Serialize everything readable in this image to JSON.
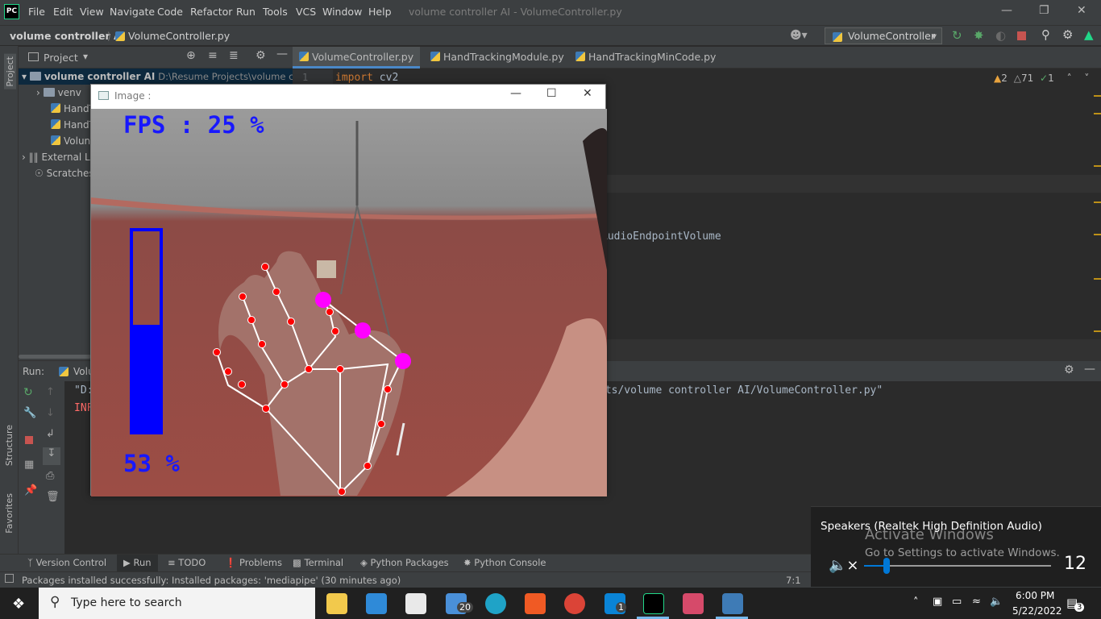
{
  "menu": {
    "logo": "PC",
    "items": [
      "File",
      "Edit",
      "View",
      "Navigate",
      "Code",
      "Refactor",
      "Run",
      "Tools",
      "VCS",
      "Window",
      "Help"
    ],
    "window_title": "volume controller AI - VolumeController.py"
  },
  "navbar": {
    "project": "volume controller AI",
    "file": "VolumeController.py",
    "run_config": "VolumeController"
  },
  "left_strip": {
    "project": "Project",
    "structure": "Structure",
    "favorites": "Favorites"
  },
  "project_panel": {
    "title": "Project",
    "root": "volume controller AI",
    "root_path": "D:\\Resume Projects\\volume contr",
    "items": [
      "venv",
      "HandT",
      "HandT",
      "Volun",
      "External L",
      "Scratches"
    ]
  },
  "tabs": [
    "VolumeController.py",
    "HandTrackingModule.py",
    "HandTrackingMinCode.py"
  ],
  "editor": {
    "line_number": "1",
    "line1_keyword": "import",
    "line1_rest": " cv2",
    "line2": "AudioEndpointVolume",
    "warnings": "2",
    "weak_warnings": "71",
    "typos": "1"
  },
  "run": {
    "label": "Run:",
    "config": "Volu",
    "line1_start": "\"D:",
    "line1_end": "cts/volume controller AI/VolumeController.py\"",
    "line2": "INF"
  },
  "bottom_tabs": [
    "Version Control",
    "Run",
    "TODO",
    "Problems",
    "Terminal",
    "Python Packages",
    "Python Console"
  ],
  "status": {
    "message": "Packages installed successfully: Installed packages: 'mediapipe' (30 minutes ago)",
    "position": "7:1"
  },
  "cv_window": {
    "title": "Image :",
    "fps_text": "FPS : 25 %",
    "volume_text": "53 %",
    "bar_fill_percent": 53
  },
  "volume_flyout": {
    "device": "Speakers (Realtek High Definition Audio)",
    "level": "12",
    "level_fraction": 0.12
  },
  "activate": {
    "title": "Activate Windows",
    "subtitle": "Go to Settings to activate Windows."
  },
  "taskbar": {
    "search_placeholder": "Type here to search",
    "mail_badge": "20",
    "phone_badge": "1",
    "time": "6:00 PM",
    "date": "5/22/2022",
    "notif_count": "3"
  }
}
